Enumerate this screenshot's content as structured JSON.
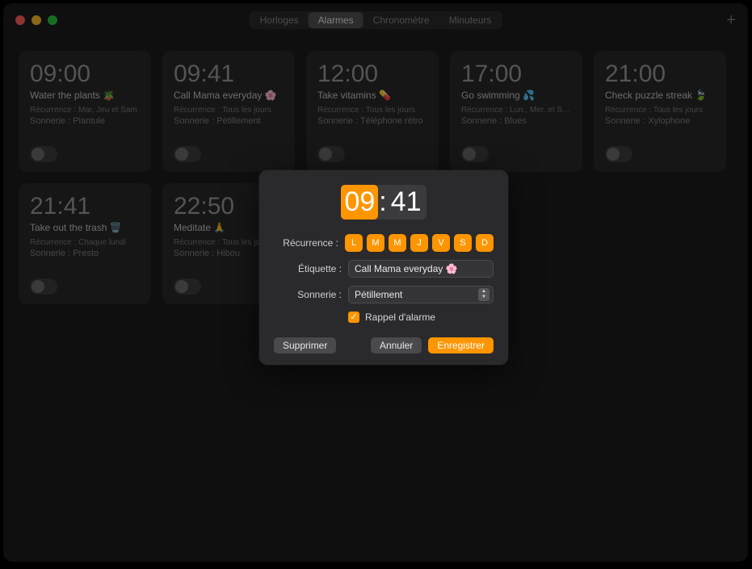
{
  "titlebar": {
    "tabs": [
      "Horloges",
      "Alarmes",
      "Chronomètre",
      "Minuteurs"
    ],
    "active_tab_index": 1,
    "add_glyph": "+"
  },
  "labels": {
    "recurrence_prefix": "Récurrence : ",
    "sound_prefix": "Sonnerie : "
  },
  "alarms": [
    {
      "time": "09:00",
      "title": "Water the plants 🪴",
      "recurrence": "Mar, Jeu et Sam",
      "sound": "Plantule"
    },
    {
      "time": "09:41",
      "title": "Call Mama everyday 🌸",
      "recurrence": "Tous les jours",
      "sound": "Pétillement"
    },
    {
      "time": "12:00",
      "title": "Take vitamins 💊",
      "recurrence": "Tous les jours",
      "sound": "Téléphone rétro"
    },
    {
      "time": "17:00",
      "title": "Go swimming 💦",
      "recurrence": "Lun., Mer. et Sam.",
      "sound": "Blues"
    },
    {
      "time": "21:00",
      "title": "Check puzzle streak 🍃",
      "recurrence": "Tous les jours",
      "sound": "Xylophone"
    },
    {
      "time": "21:41",
      "title": "Take out the trash 🗑️",
      "recurrence": "Chaque lundi",
      "sound": "Presto"
    },
    {
      "time": "22:50",
      "title": "Meditate 🙏",
      "recurrence": "Tous les jours",
      "sound": "Hibou"
    }
  ],
  "modal": {
    "hour": "09",
    "minute": "41",
    "recurrence_label": "Récurrence :",
    "days": [
      "L",
      "M",
      "M",
      "J",
      "V",
      "S",
      "D"
    ],
    "etiquette_label": "Étiquette :",
    "etiquette_value": "Call Mama everyday 🌸",
    "sonnerie_label": "Sonnerie :",
    "sonnerie_value": "Pétillement",
    "snooze_label": "Rappel d'alarme",
    "snooze_checked": true,
    "delete_label": "Supprimer",
    "cancel_label": "Annuler",
    "save_label": "Enregistrer"
  }
}
